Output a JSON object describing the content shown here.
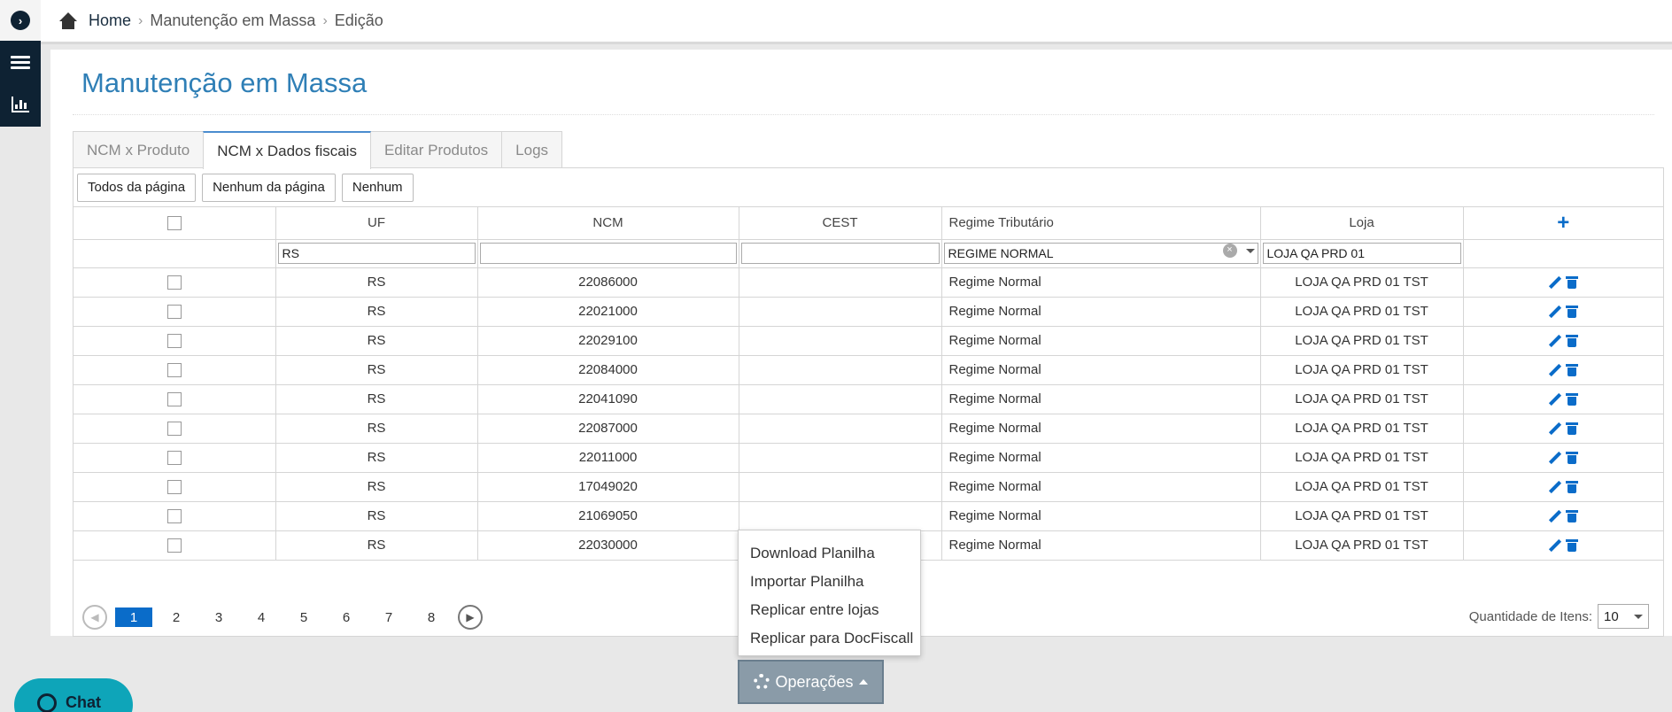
{
  "breadcrumb": [
    "Home",
    "Manutenção em Massa",
    "Edição"
  ],
  "page_title": "Manutenção em Massa",
  "tabs": [
    {
      "label": "NCM x Produto",
      "active": false
    },
    {
      "label": "NCM x Dados fiscais",
      "active": true
    },
    {
      "label": "Editar Produtos",
      "active": false
    },
    {
      "label": "Logs",
      "active": false
    }
  ],
  "selection_buttons": [
    "Todos da página",
    "Nenhum da página",
    "Nenhum"
  ],
  "columns": [
    "UF",
    "NCM",
    "CEST",
    "Regime Tributário",
    "Loja"
  ],
  "filters": {
    "uf": "RS",
    "ncm": "",
    "cest": "",
    "regime": "REGIME NORMAL",
    "loja": "LOJA QA PRD 01"
  },
  "rows": [
    {
      "uf": "RS",
      "ncm": "22086000",
      "cest": "",
      "regime": "Regime Normal",
      "loja": "LOJA QA PRD 01 TST"
    },
    {
      "uf": "RS",
      "ncm": "22021000",
      "cest": "",
      "regime": "Regime Normal",
      "loja": "LOJA QA PRD 01 TST"
    },
    {
      "uf": "RS",
      "ncm": "22029100",
      "cest": "",
      "regime": "Regime Normal",
      "loja": "LOJA QA PRD 01 TST"
    },
    {
      "uf": "RS",
      "ncm": "22084000",
      "cest": "",
      "regime": "Regime Normal",
      "loja": "LOJA QA PRD 01 TST"
    },
    {
      "uf": "RS",
      "ncm": "22041090",
      "cest": "",
      "regime": "Regime Normal",
      "loja": "LOJA QA PRD 01 TST"
    },
    {
      "uf": "RS",
      "ncm": "22087000",
      "cest": "",
      "regime": "Regime Normal",
      "loja": "LOJA QA PRD 01 TST"
    },
    {
      "uf": "RS",
      "ncm": "22011000",
      "cest": "",
      "regime": "Regime Normal",
      "loja": "LOJA QA PRD 01 TST"
    },
    {
      "uf": "RS",
      "ncm": "17049020",
      "cest": "",
      "regime": "Regime Normal",
      "loja": "LOJA QA PRD 01 TST"
    },
    {
      "uf": "RS",
      "ncm": "21069050",
      "cest": "",
      "regime": "Regime Normal",
      "loja": "LOJA QA PRD 01 TST"
    },
    {
      "uf": "RS",
      "ncm": "22030000",
      "cest": "",
      "regime": "Regime Normal",
      "loja": "LOJA QA PRD 01 TST"
    }
  ],
  "pagination": {
    "pages": [
      "1",
      "2",
      "3",
      "4",
      "5",
      "6",
      "7",
      "8"
    ],
    "current": "1"
  },
  "quantity": {
    "label": "Quantidade de Itens:",
    "value": "10"
  },
  "operations_menu": [
    "Download Planilha",
    "Importar Planilha",
    "Replicar entre lojas",
    "Replicar para DocFiscall"
  ],
  "operations_button": "Operações",
  "chat_label": "Chat",
  "colors": {
    "accent": "#0a6cc9",
    "title": "#2f7fb6",
    "rail": "#0e2233",
    "chat": "#0ea5b9"
  }
}
